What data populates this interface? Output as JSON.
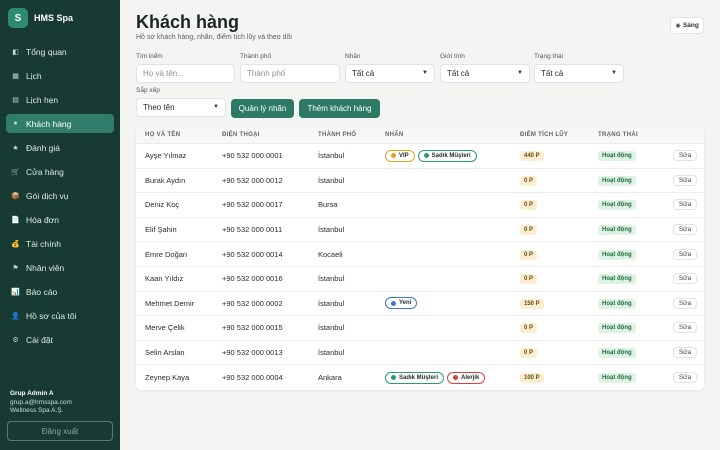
{
  "brand": {
    "logo_letter": "S",
    "name": "HMS Spa"
  },
  "nav": [
    {
      "label": "Tổng quan",
      "icon": "◧",
      "icon_name": "dashboard-icon"
    },
    {
      "label": "Lịch",
      "icon": "▦",
      "icon_name": "calendar-icon"
    },
    {
      "label": "Lịch hẹn",
      "icon": "▤",
      "icon_name": "appointments-icon"
    },
    {
      "label": "Khách hàng",
      "icon": "●",
      "icon_name": "customers-icon",
      "active": true
    },
    {
      "label": "Đánh giá",
      "icon": "★",
      "icon_name": "star-icon"
    },
    {
      "label": "Cửa hàng",
      "icon": "🛒",
      "icon_name": "cart-icon"
    },
    {
      "label": "Gói dịch vụ",
      "icon": "📦",
      "icon_name": "package-icon"
    },
    {
      "label": "Hóa đơn",
      "icon": "📄",
      "icon_name": "invoice-icon"
    },
    {
      "label": "Tài chính",
      "icon": "💰",
      "icon_name": "finance-icon"
    },
    {
      "label": "Nhân viên",
      "icon": "⚑",
      "icon_name": "staff-icon"
    },
    {
      "label": "Báo cáo",
      "icon": "📊",
      "icon_name": "report-icon"
    },
    {
      "label": "Hồ sơ của tôi",
      "icon": "👤",
      "icon_name": "profile-icon"
    },
    {
      "label": "Cài đặt",
      "icon": "⚙",
      "icon_name": "settings-icon"
    }
  ],
  "user": {
    "name": "Grup Admin A",
    "email": "grup.a@hmsspa.com",
    "org": "Wellness Spa A.Ş."
  },
  "logout_label": "Đăng xuất",
  "header": {
    "title": "Khách hàng",
    "subtitle": "Hồ sơ khách hàng, nhãn, điểm tích lũy và theo dõi",
    "theme_icon": "☀",
    "theme_label": "Sáng"
  },
  "filters": {
    "search": {
      "label": "Tìm kiếm",
      "placeholder": "Họ và tên..."
    },
    "city": {
      "label": "Thành phố",
      "placeholder": "Thành phố"
    },
    "tag": {
      "label": "Nhãn",
      "value": "Tất cả"
    },
    "gender": {
      "label": "Giới tính",
      "value": "Tất cả"
    },
    "status": {
      "label": "Trạng thái",
      "value": "Tất cả"
    },
    "sort": {
      "label": "Sắp xếp",
      "value": "Theo tên"
    }
  },
  "buttons": {
    "manage_tags": "Quản lý nhãn",
    "add_customer": "Thêm khách hàng"
  },
  "table": {
    "headers": [
      "HỌ VÀ TÊN",
      "ĐIỆN THOẠI",
      "THÀNH PHỐ",
      "NHÃN",
      "ĐIỂM TÍCH LŨY",
      "TRẠNG THÁI"
    ],
    "status_label": "Hoạt động",
    "edit_label": "Sửa",
    "rows": [
      {
        "name": "Ayşe Yılmaz",
        "phone": "+90 532 000 0001",
        "city": "İstanbul",
        "tags": [
          {
            "label": "VIP",
            "color": "#e0a31f"
          },
          {
            "label": "Sadık Müşteri",
            "color": "#2c9a74"
          }
        ],
        "points": "440 P"
      },
      {
        "name": "Burak Aydın",
        "phone": "+90 532 000 0012",
        "city": "İstanbul",
        "tags": [],
        "points": "0 P"
      },
      {
        "name": "Deniz Koç",
        "phone": "+90 532 000 0017",
        "city": "Bursa",
        "tags": [],
        "points": "0 P"
      },
      {
        "name": "Elif Şahin",
        "phone": "+90 532 000 0011",
        "city": "İstanbul",
        "tags": [],
        "points": "0 P"
      },
      {
        "name": "Emre Doğan",
        "phone": "+90 532 000 0014",
        "city": "Kocaeli",
        "tags": [],
        "points": "0 P"
      },
      {
        "name": "Kaan Yıldız",
        "phone": "+90 532 000 0016",
        "city": "İstanbul",
        "tags": [],
        "points": "0 P"
      },
      {
        "name": "Mehmet Demir",
        "phone": "+90 532 000 0002",
        "city": "İstanbul",
        "tags": [
          {
            "label": "Yeni",
            "color": "#3a78d4"
          }
        ],
        "points": "150 P"
      },
      {
        "name": "Merve Çelik",
        "phone": "+90 532 000 0015",
        "city": "İstanbul",
        "tags": [],
        "points": "0 P"
      },
      {
        "name": "Selin Arslan",
        "phone": "+90 532 000 0013",
        "city": "İstanbul",
        "tags": [],
        "points": "0 P"
      },
      {
        "name": "Zeynep Kaya",
        "phone": "+90 532 000 0004",
        "city": "Ankara",
        "tags": [
          {
            "label": "Sadık Müşteri",
            "color": "#2c9a74"
          },
          {
            "label": "Alerjik",
            "color": "#d94040"
          }
        ],
        "points": "100 P"
      }
    ]
  }
}
